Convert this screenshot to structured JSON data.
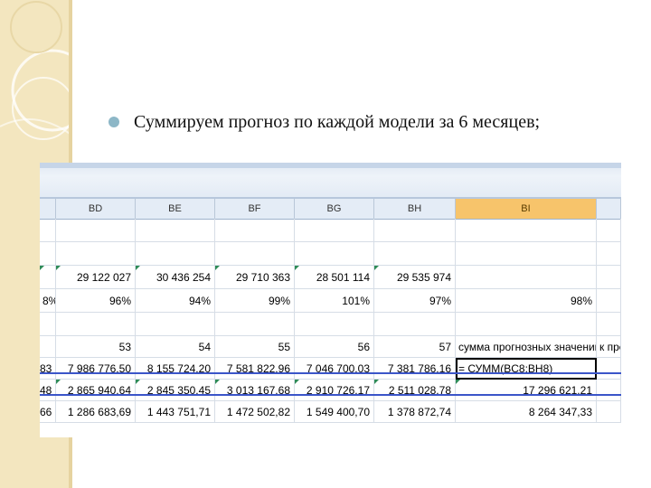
{
  "slide": {
    "bullet_text": "Суммируем прогноз по каждой модели за 6 месяцев;",
    "bullet_color": "#8db7c7",
    "strip_color": "#f3e6bf"
  },
  "sheet": {
    "columns": [
      "",
      "BD",
      "BE",
      "BF",
      "BG",
      "BH",
      "BI",
      ""
    ],
    "selected_column": "BI",
    "rows": [
      [
        "",
        "",
        "",
        "",
        "",
        "",
        "",
        ""
      ],
      [
        "",
        "",
        "",
        "",
        "",
        "",
        "",
        ""
      ],
      [
        "",
        "29 122 027",
        "30 436 254",
        "29 710 363",
        "28 501 114",
        "29 535 974",
        "",
        ""
      ],
      [
        "8%",
        "96%",
        "94%",
        "99%",
        "101%",
        "97%",
        "98%",
        ""
      ],
      [
        "",
        "",
        "",
        "",
        "",
        "",
        "",
        ""
      ],
      [
        "",
        "53",
        "54",
        "55",
        "56",
        "57",
        "сумма прогнозных значений",
        "к пре"
      ],
      [
        "83",
        "7 986 776,50",
        "8 155 724,20",
        "7 581 822,96",
        "7 046 700,03",
        "7 381 786,16",
        "= СУММ(BC8:BH8)",
        ""
      ],
      [
        "48",
        "2 865 940,64",
        "2 845 350,45",
        "3 013 167,68",
        "2 910 726,17",
        "2 511 028,78",
        "17 296 621,21",
        ""
      ],
      [
        "66",
        "1 286 683,69",
        "1 443 751,71",
        "1 472 502,82",
        "1 549 400,70",
        "1 378 872,74",
        "8 264 347,33",
        ""
      ]
    ],
    "accent_color": "#f7c46b",
    "highlight_line_color": "#3b55c9"
  }
}
